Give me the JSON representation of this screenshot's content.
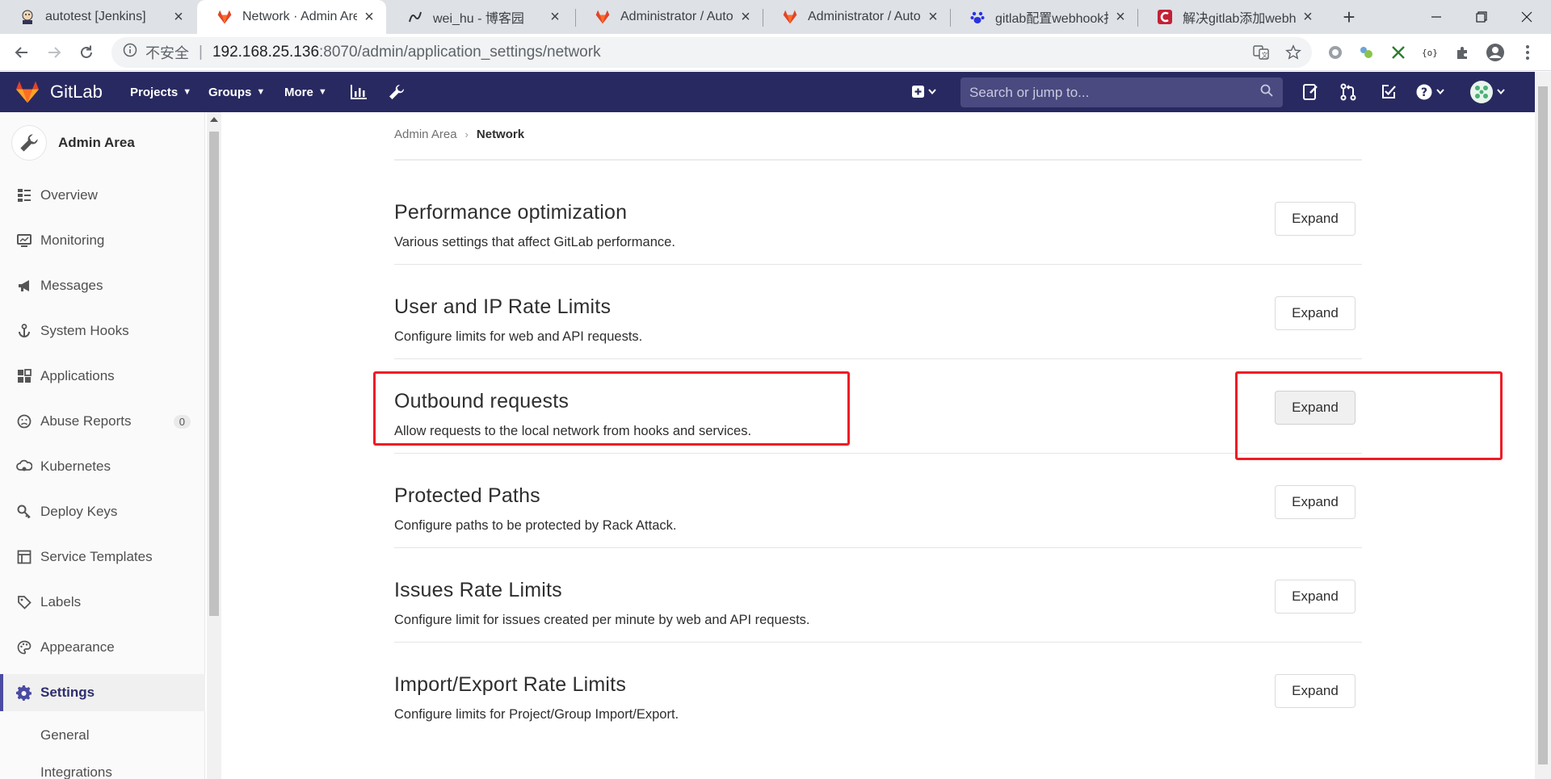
{
  "browser": {
    "tabs": [
      {
        "title": "autotest [Jenkins]",
        "icon": "jenkins-icon"
      },
      {
        "title": "Network · Admin Area",
        "icon": "gitlab-icon"
      },
      {
        "title": "wei_hu - 博客园",
        "icon": "cnblogs-icon"
      },
      {
        "title": "Administrator / Auto",
        "icon": "gitlab-icon"
      },
      {
        "title": "Administrator / Auto",
        "icon": "gitlab-icon"
      },
      {
        "title": "gitlab配置webhook报",
        "icon": "baidu-icon"
      },
      {
        "title": "解决gitlab添加webhook",
        "icon": "csdn-icon"
      }
    ],
    "address": {
      "security": "不安全",
      "host": "192.168.25.136",
      "path": ":8070/admin/application_settings/network"
    }
  },
  "gitlab": {
    "brand": "GitLab",
    "menu": {
      "projects": "Projects",
      "groups": "Groups",
      "more": "More"
    },
    "search_placeholder": "Search or jump to..."
  },
  "sidebar": {
    "title": "Admin Area",
    "items": {
      "overview": "Overview",
      "monitoring": "Monitoring",
      "messages": "Messages",
      "system_hooks": "System Hooks",
      "applications": "Applications",
      "abuse_reports": "Abuse Reports",
      "abuse_count": "0",
      "kubernetes": "Kubernetes",
      "deploy_keys": "Deploy Keys",
      "service_templates": "Service Templates",
      "labels": "Labels",
      "appearance": "Appearance",
      "settings": "Settings",
      "general": "General",
      "integrations": "Integrations"
    }
  },
  "breadcrumb": {
    "root": "Admin Area",
    "current": "Network"
  },
  "sections": [
    {
      "title": "Performance optimization",
      "desc": "Various settings that affect GitLab performance.",
      "button": "Expand"
    },
    {
      "title": "User and IP Rate Limits",
      "desc": "Configure limits for web and API requests.",
      "button": "Expand"
    },
    {
      "title": "Outbound requests",
      "desc": "Allow requests to the local network from hooks and services.",
      "button": "Expand"
    },
    {
      "title": "Protected Paths",
      "desc": "Configure paths to be protected by Rack Attack.",
      "button": "Expand"
    },
    {
      "title": "Issues Rate Limits",
      "desc": "Configure limit for issues created per minute by web and API requests.",
      "button": "Expand"
    },
    {
      "title": "Import/Export Rate Limits",
      "desc": "Configure limits for Project/Group Import/Export.",
      "button": "Expand"
    }
  ],
  "colors": {
    "nav": "#292961",
    "annotation": "#ee1c25",
    "accent": "#4b4ba3"
  }
}
